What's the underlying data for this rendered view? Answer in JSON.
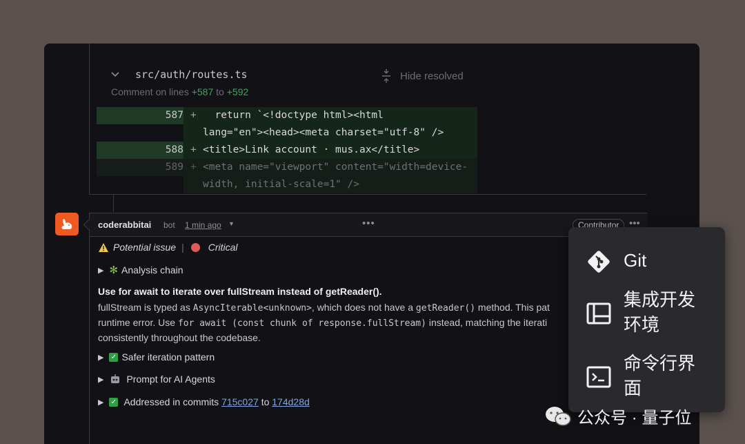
{
  "file_header": {
    "path": "src/auth/routes.ts",
    "hide_resolved": "Hide resolved",
    "comment_prefix": "Comment on lines",
    "line_start": "+587",
    "line_sep": "to",
    "line_end": "+592"
  },
  "code_lines": [
    {
      "num": "587",
      "sign": "+",
      "text": "  return `<!doctype html><html"
    },
    {
      "num": "",
      "sign": "",
      "text": "lang=\"en\"><head><meta charset=\"utf-8\" />"
    },
    {
      "num": "588",
      "sign": "+",
      "text": "<title>Link account · mus.ax</title>"
    },
    {
      "num": "589",
      "sign": "+",
      "text": "<meta name=\"viewport\" content=\"width=device-"
    },
    {
      "num": "",
      "sign": "",
      "text": "width, initial-scale=1\" />"
    }
  ],
  "comment": {
    "author": "coderabbitai",
    "bot_label": "bot",
    "time": "1 min ago",
    "role_badge": "Contributor",
    "potential_issue": "Potential issue",
    "severity": "Critical",
    "analysis_chain": "Analysis chain",
    "title": "Use for await to iterate over fullStream instead of getReader().",
    "para_line1_a": "fullStream is typed as ",
    "para_line1_code1": "AsyncIterable<unknown>",
    "para_line1_b": ", which does not have a ",
    "para_line1_code2": "getReader()",
    "para_line1_c": " method. This pat",
    "para_line2_a": "runtime error. Use ",
    "para_line2_code": "for await (const chunk of response.fullStream)",
    "para_line2_b": " instead, matching the iterati",
    "para_line3": "consistently throughout the codebase.",
    "safer": "Safer iteration pattern",
    "prompt": "Prompt for AI Agents",
    "addressed": "Addressed in commits",
    "commit1": "715c027",
    "commit_sep": "to",
    "commit2": "174d28d"
  },
  "menu": {
    "items": [
      {
        "label": "Git",
        "icon": "git-icon"
      },
      {
        "label": "集成开发环境",
        "icon": "ide-icon"
      },
      {
        "label": "命令行界面",
        "icon": "terminal-icon"
      }
    ]
  },
  "watermark": {
    "text": "公众号 · 量子位"
  },
  "colors": {
    "accent_orange": "#ef5a23",
    "diff_green": "#3fa55a",
    "critical_red": "#e05a5a",
    "link_blue": "#7fa6e0"
  }
}
